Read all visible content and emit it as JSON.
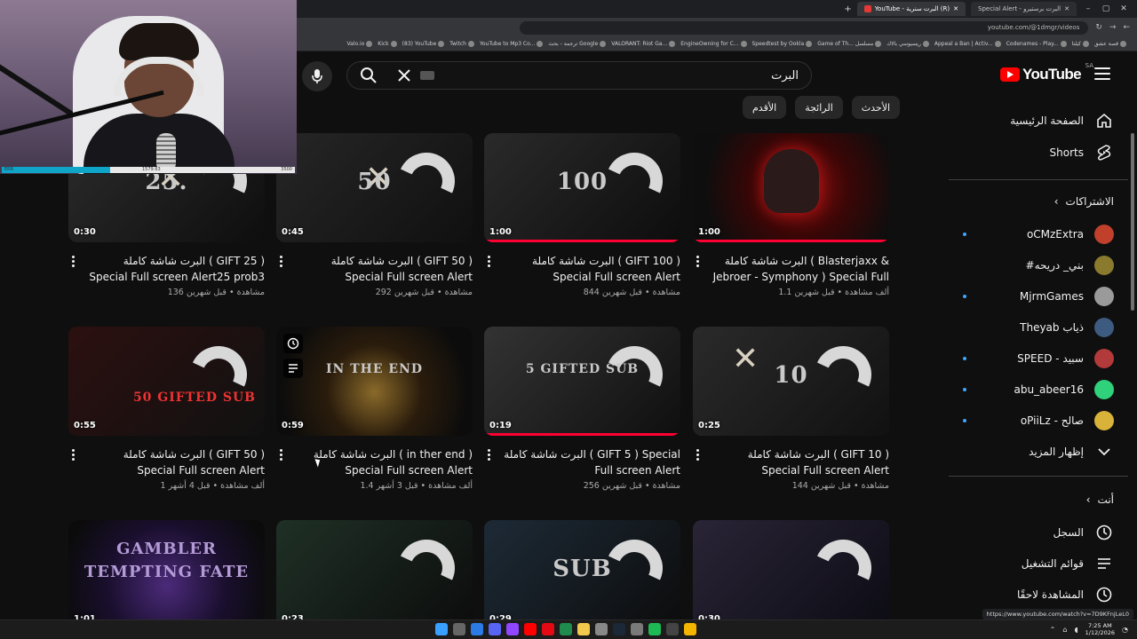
{
  "browser": {
    "tabs": [
      {
        "label": "YouTube - ‎البرت سنرية (R)‎",
        "active": true
      },
      {
        "label": "Special Alert - ‎البرت برستيرو‎",
        "active": false
      }
    ],
    "url": "youtube.com/@1dmgr/videos",
    "bookmarks": [
      "Valo.io",
      "Kick",
      "(83) YouTube",
      "Twitch",
      "YouTube to Mp3 Co...",
      "ترجمة - بحث Google",
      "VALORANT: Riot Ga...",
      "EngineOwning for C...",
      "Speedtest by Ookla",
      "Game of Th... مسلسل",
      "ريسيوسي بالاك",
      "Appeal a Ban | Activ...",
      "Codenames - Play...",
      "كيلتا",
      "قصة عشق"
    ],
    "status_url": "https://www.youtube.com/watch?v=7D9KFnjLeL0"
  },
  "webcam": {
    "progress_fraction": 0.37,
    "progress_left_label": "ERR",
    "progress_mid_label": "1579.63",
    "progress_right_label": "3500"
  },
  "header": {
    "logo_text": "YouTube",
    "country_code": "SA",
    "search_query": "البرت"
  },
  "chips": [
    "الأقدم",
    "الرائجة",
    "الأحدث"
  ],
  "sidebar": {
    "home": "الصفحة الرئيسية",
    "shorts": "Shorts",
    "subscriptions_heading": "الاشتراكات",
    "subscriptions": [
      {
        "name": "oCMzExtra",
        "live": true,
        "color": "#c0402c"
      },
      {
        "name": "#بني_ دريحه",
        "live": false,
        "color": "#8a7a2e"
      },
      {
        "name": "MjrmGames",
        "live": true,
        "color": "#9a9a9a"
      },
      {
        "name": "Theyab ذياب",
        "live": false,
        "color": "#3d5a80"
      },
      {
        "name": "SPEED - سبيد",
        "live": true,
        "color": "#b33a3a"
      },
      {
        "name": "abu_abeer16",
        "live": true,
        "color": "#2fd17a"
      },
      {
        "name": "oPiiLz - صالح",
        "live": true,
        "color": "#d9b23a"
      }
    ],
    "show_more": "إظهار المزيد",
    "you_heading": "أنت",
    "history": "السجل",
    "playlists": "قوائم التشغيل",
    "watch_later": "المشاهدة لاحقًا"
  },
  "videos": [
    {
      "title": "البرت شاشة كاملة ( Blasterjaxx & Jebroer - Symphony ) Special Full screen...",
      "stats": "1.1 ألف مشاهدة • قبل شهرين",
      "duration": "1:00",
      "overlay": "",
      "progress": 1.0
    },
    {
      "title": "البرت شاشة كاملة ( GIFT 100 ) Special Full screen Alert",
      "stats": "844 مشاهدة • قبل شهرين",
      "duration": "1:00",
      "overlay": "100",
      "progress": 1.0
    },
    {
      "title": "البرت شاشة كاملة ( GIFT 50 ) Special Full screen Alert",
      "stats": "292 مشاهدة • قبل شهرين",
      "duration": "0:45",
      "overlay": "50",
      "progress": 0
    },
    {
      "title": "البرت شاشة كاملة ( GIFT 25 ) Special Full screen Alert25 prob3",
      "stats": "136 مشاهدة • قبل شهرين",
      "duration": "0:30",
      "overlay": "25.",
      "progress": 0
    },
    {
      "title": "البرت شاشة كاملة ( GIFT 10 ) Special Full screen Alert",
      "stats": "144 مشاهدة • قبل شهرين",
      "duration": "0:25",
      "overlay": "10",
      "progress": 0
    },
    {
      "title": "البرت شاشة كاملة ( GIFT 5 ) Special Full screen Alert",
      "stats": "256 مشاهدة • قبل شهرين",
      "duration": "0:19",
      "overlay": "5 GIFTED SUB",
      "progress": 1.0
    },
    {
      "title": "البرت شاشة كاملة ( in ther end ) Special Full screen Alert",
      "stats": "1.4 ألف مشاهدة • قبل 3 أشهر",
      "duration": "0:59",
      "overlay": "IN THE END",
      "progress": 0
    },
    {
      "title": "البرت شاشة كاملة ( GIFT 50 ) Special Full screen Alert",
      "stats": "1 ألف مشاهدة • قبل 4 أشهر",
      "duration": "0:55",
      "overlay": "50 GIFTED SUB",
      "progress": 0
    },
    {
      "title": "",
      "stats": "",
      "duration": "0:30",
      "overlay": "",
      "progress": 0
    },
    {
      "title": "",
      "stats": "",
      "duration": "0:29",
      "overlay": "SUB",
      "progress": 0
    },
    {
      "title": "",
      "stats": "",
      "duration": "0:23",
      "overlay": "",
      "progress": 0
    },
    {
      "title": "",
      "stats": "",
      "duration": "1:01",
      "overlay": "GAMBLER TEMPTING FATE",
      "progress": 0
    }
  ],
  "taskbar": {
    "time": "7:25 AM",
    "date": "1/12/2026"
  }
}
